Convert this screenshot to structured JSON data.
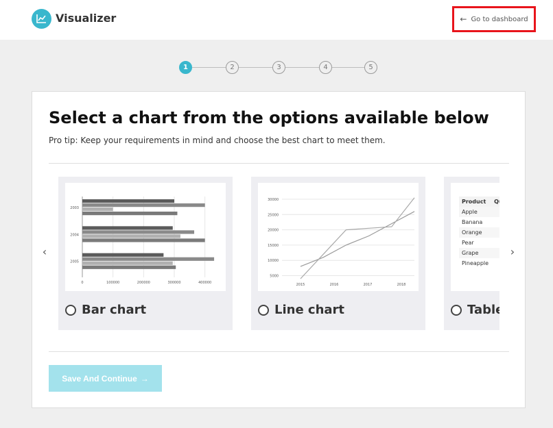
{
  "app": {
    "name": "Visualizer"
  },
  "header": {
    "dashboard_link": "Go to dashboard"
  },
  "stepper": {
    "steps": [
      "1",
      "2",
      "3",
      "4",
      "5"
    ],
    "active_index": 0
  },
  "main": {
    "title": "Select a chart from the options available below",
    "tip": "Pro tip: Keep your requirements in mind and choose the best chart to meet them."
  },
  "options": [
    {
      "label": "Bar chart",
      "selected": false
    },
    {
      "label": "Line chart",
      "selected": false
    },
    {
      "label": "Table",
      "selected": false
    }
  ],
  "previews": {
    "bar": {
      "categories": [
        "2003",
        "2004",
        "2005"
      ],
      "x_ticks": [
        "0",
        "100000",
        "200000",
        "300000",
        "400000"
      ],
      "series_values": [
        [
          300000,
          400000,
          100000,
          310000
        ],
        [
          295000,
          365000,
          320000,
          400000
        ],
        [
          265000,
          430000,
          295000,
          305000
        ]
      ],
      "xlim": [
        0,
        450000
      ]
    },
    "line": {
      "x_ticks": [
        "2015",
        "2016",
        "2017",
        "2018"
      ],
      "y_ticks": [
        "5000",
        "10000",
        "15000",
        "20000",
        "25000",
        "30000"
      ],
      "series": [
        {
          "values": [
            8000,
            11000,
            15000,
            18000,
            22000,
            26000
          ]
        },
        {
          "values": [
            4000,
            12000,
            20000,
            20500,
            21000,
            30500
          ]
        }
      ],
      "ylim": [
        4000,
        32000
      ]
    },
    "table": {
      "headers": [
        "Product",
        "Qua"
      ],
      "rows": [
        "Apple",
        "Banana",
        "Orange",
        "Pear",
        "Grape",
        "Pineapple"
      ]
    }
  },
  "save_button": {
    "label": "Save And Continue",
    "arrow": "→"
  },
  "icons": {
    "logo": "line-chart-icon",
    "back": "arrow-left-icon",
    "prev": "chevron-left-icon",
    "next": "chevron-right-icon"
  },
  "colors": {
    "accent": "#39b7cd",
    "save_button": "#a3e2ec",
    "highlight": "#e8141b"
  }
}
